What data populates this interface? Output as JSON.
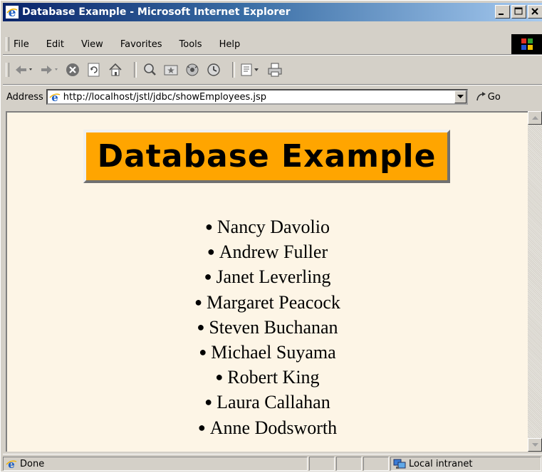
{
  "window": {
    "title": "Database Example - Microsoft Internet Explorer",
    "title_color": "#0a246a",
    "icons": [
      "ie-icon",
      "minimize-icon",
      "maximize-icon",
      "close-icon"
    ]
  },
  "menubar": {
    "items": [
      "File",
      "Edit",
      "View",
      "Favorites",
      "Tools",
      "Help"
    ]
  },
  "toolbar": {
    "icons": [
      "back-icon",
      "forward-icon",
      "stop-icon",
      "refresh-icon",
      "home-icon",
      "search-icon",
      "favorites-icon",
      "media-icon",
      "history-icon",
      "mail-icon",
      "print-icon"
    ]
  },
  "address": {
    "label": "Address",
    "url": "http://localhost/jstl/jdbc/showEmployees.jsp",
    "go_label": "Go"
  },
  "page": {
    "background": "#fdf5e6",
    "banner_title": "Database Example",
    "banner_color": "#ffa500",
    "employees": [
      "Nancy Davolio",
      "Andrew Fuller",
      "Janet Leverling",
      "Margaret Peacock",
      "Steven Buchanan",
      "Michael Suyama",
      "Robert King",
      "Laura Callahan",
      "Anne Dodsworth"
    ]
  },
  "status": {
    "text": "Done",
    "zone": "Local intranet"
  }
}
